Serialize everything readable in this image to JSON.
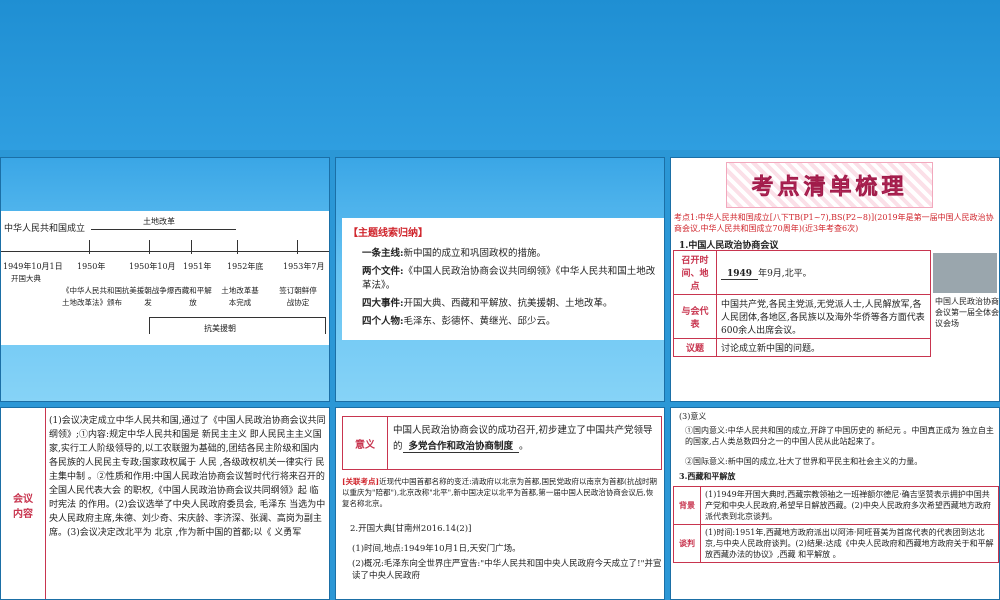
{
  "slide1": {
    "country_founded": "中华人民共和国成立",
    "land_reform_label": "土地改革",
    "resist_label": "抗美援朝",
    "dates": [
      "1949年10月1日",
      "1950年",
      "1950年10月",
      "1951年",
      "1952年底",
      "1953年7月"
    ],
    "events": [
      "开国大典",
      "《中华人民共和国土地改革法》颁布",
      "抗美援朝战争爆发",
      "西藏和平解放",
      "土地改革基本完成",
      "签订朝鲜停战协定"
    ]
  },
  "slide2": {
    "heading": "【主题线索归纳】",
    "lines": [
      {
        "k": "一条主线:",
        "v": "新中国的成立和巩固政权的措施。"
      },
      {
        "k": "两个文件:",
        "v": "《中国人民政治协商会议共同纲领》《中华人民共和国土地改革法》。"
      },
      {
        "k": "四大事件:",
        "v": "开国大典、西藏和平解放、抗美援朝、土地改革。"
      },
      {
        "k": "四个人物:",
        "v": "毛泽东、彭德怀、黄继光、邱少云。"
      }
    ]
  },
  "slide3": {
    "banner": "考点清单梳理",
    "kaodian": "考点1:中华人民共和国成立[八下TB(P1~7),BS(P2~8)](2019年是第一届中国人民政治协商会议,中华人民共和国成立70周年)(近3年考查6次)",
    "subtitle": "1.中国人民政治协商会议",
    "rows": [
      {
        "label": "召开时间、地点",
        "value": "1949",
        "rest": "年9月,北平。"
      },
      {
        "label": "与会代表",
        "value": "中国共产党,各民主党派,无党派人士,人民解放军,各人民团体,各地区,各民族以及海外华侨等各方面代表600余人出席会议。"
      },
      {
        "label": "议题",
        "value": "讨论成立新中国的问题。"
      }
    ],
    "photo_caption": "中国人民政治协商会议第一届全体会议会场"
  },
  "slide4": {
    "label": "会议内容",
    "paragraph": "(1)会议决定成立中华人民共和国,通过了《中国人民政治协商会议共同纲领》;①内容:规定中华人民共和国是 新民主主义 即人民民主主义国家,实行工人阶级领导的,以工农联盟为基础的,团结各民主阶级和国内各民族的人民民主专政;国家政权属于 人民 ,各级政权机关一律实行 民主集中制 。②性质和作用:中国人民政治协商会议暂时代行将来召开的 全国人民代表大会 的职权,《中国人民政治协商会议共同纲领》起 临时宪法 的作用。(2)会议选举了中央人民政府委员会, 毛泽东 当选为中央人民政府主席,朱德、刘少奇、宋庆龄、李济深、张澜、高岗为副主席。(3)会议决定改北平为 北京 ,作为新中国的首都;以《 义勇军"
  },
  "slide5": {
    "label": "意义",
    "text": "中国人民政治协商会议的成功召开,初步建立了中国共产党领导的",
    "blank": "多党合作和政治协商制度",
    "tail": "。",
    "note_head": "[关联考点]",
    "note": "近现代中国首都名称的变迁:清政府以北京为首都,国民党政府以南京为首都(抗战时期以重庆为\"陪都\"),北京改称\"北平\",新中国决定以北平为首都,第一届中国人民政治协商会议后,恢复名称北京。",
    "item2": "2.开国大典[甘南州2016.14(2)]",
    "item2a": "(1)时间,地点:1949年10月1日,天安门广场。",
    "item2b": "(2)概况:毛泽东向全世界庄严宣告:\"中华人民共和国中央人民政府今天成立了!\"并宣读了中央人民政府"
  },
  "slide6": {
    "s3": "(3)意义",
    "m1": "①国内意义:中华人民共和国的成立,开辟了中国历史的 新纪元 。中国真正成为 独立自主 的国家,占人类总数四分之一的中国人民从此站起来了。",
    "m2": "②国际意义:新中国的成立,壮大了世界和平民主和社会主义的力量。",
    "s4": "3.西藏和平解放",
    "rows": [
      {
        "label": "背景",
        "text": "(1)1949年开国大典时,西藏宗教领袖之一班禅额尔德尼·确吉坚赞表示拥护中国共产党和中央人民政府,希望早日解放西藏。(2)中央人民政府多次希望西藏地方政府派代表到北京谈判。"
      },
      {
        "label": "谈判",
        "text": "(1)时间:1951年,西藏地方政府派出以阿沛·阿旺晋美为首席代表的代表团到达北京,与中央人民政府谈判。(2)结果:达成《中央人民政府和西藏地方政府关于和平解放西藏办法的协议》,西藏 和平解放 。"
      }
    ]
  }
}
